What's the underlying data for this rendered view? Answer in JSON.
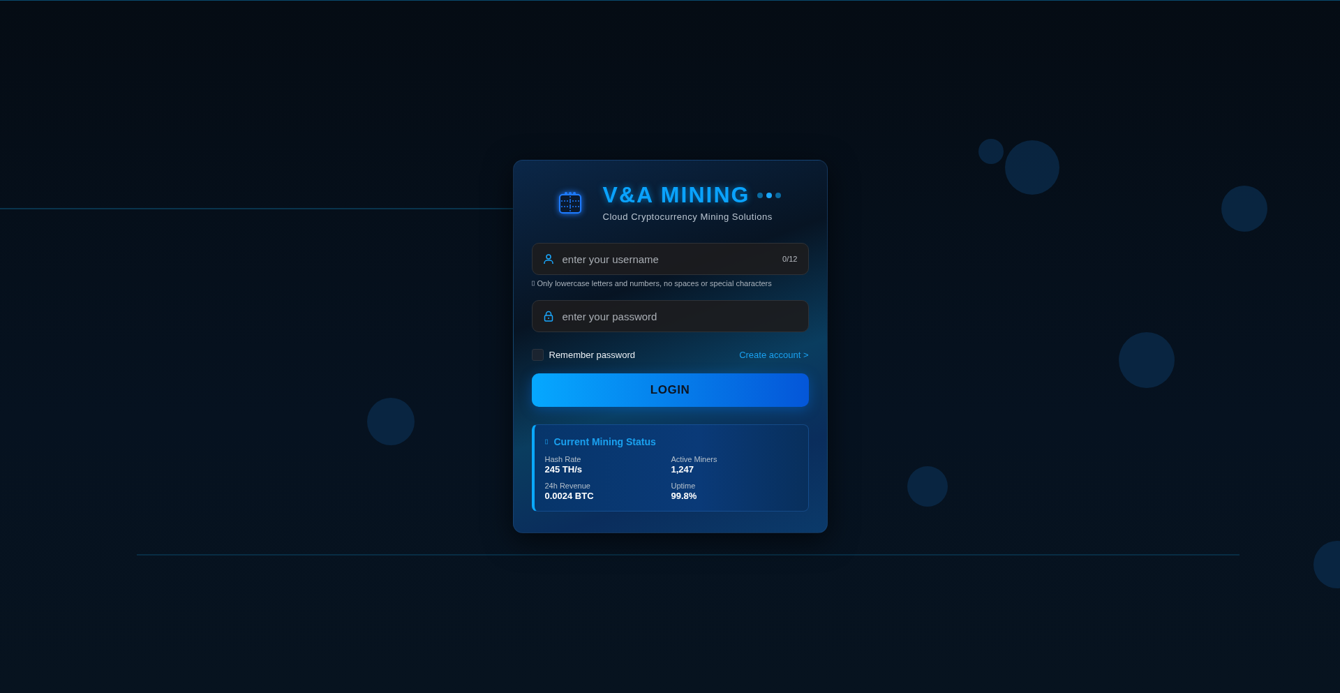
{
  "brand": {
    "title": "V&A MINING",
    "subtitle": "Cloud Cryptocurrency Mining Solutions"
  },
  "username": {
    "placeholder": "enter your username",
    "counter": "0/12",
    "hint": "Only lowercase letters and numbers, no spaces or special characters"
  },
  "password": {
    "placeholder": "enter your password"
  },
  "remember": {
    "label": "Remember password",
    "checked": false
  },
  "create_account": "Create account >",
  "login_button": "LOGIN",
  "status": {
    "title": "Current Mining Status",
    "stats": [
      {
        "label": "Hash Rate",
        "value": "245 TH/s"
      },
      {
        "label": "Active Miners",
        "value": "1,247"
      },
      {
        "label": "24h Revenue",
        "value": "0.0024 BTC"
      },
      {
        "label": "Uptime",
        "value": "99.8%"
      }
    ]
  }
}
